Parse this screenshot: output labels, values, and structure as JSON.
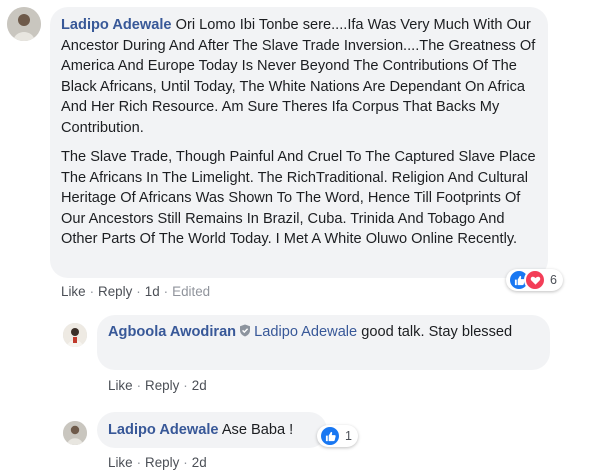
{
  "colors": {
    "link_blue": "#385898",
    "bubble_bg": "#f2f3f5",
    "action_text": "#4b4f56",
    "like_blue": "#1877f2",
    "love_red": "#f33e58"
  },
  "comment": {
    "author": "Ladipo Adewale",
    "paragraph_1_rest": "Ori Lomo Ibi Tonbe sere....Ifa Was Very Much With Our Ancestor During And After The Slave Trade Inversion....The Greatness Of America And Europe Today Is Never Beyond The Contributions Of The Black Africans, Until Today, The White Nations Are Dependant On Africa And Her Rich Resource. Am Sure Theres Ifa Corpus That Backs My Contribution.",
    "paragraph_2": "The Slave Trade, Though Painful And Cruel To The Captured Slave Place The Africans In The Limelight. The RichTraditional. Religion And Cultural Heritage Of Africans Was Shown To The Word, Hence Till Footprints Of Our Ancestors Still Remains In Brazil, Cuba. Trinida And Tobago And Other Parts Of The World Today. I Met A White Oluwo Online Recently.",
    "reactions": {
      "icons": [
        "like-icon",
        "love-icon"
      ],
      "count": "6"
    },
    "actions": {
      "like": "Like",
      "reply": "Reply",
      "time": "1d",
      "edited": "Edited"
    }
  },
  "reply_1": {
    "author": "Agboola Awodiran",
    "badge_icon": "shield-badge-icon",
    "mention": "Ladipo Adewale",
    "text": "good talk. Stay blessed",
    "actions": {
      "like": "Like",
      "reply": "Reply",
      "time": "2d"
    }
  },
  "reply_2": {
    "author": "Ladipo Adewale",
    "text": "Ase Baba !",
    "reactions": {
      "icons": [
        "like-icon"
      ],
      "count": "1"
    },
    "actions": {
      "like": "Like",
      "reply": "Reply",
      "time": "2d"
    }
  }
}
